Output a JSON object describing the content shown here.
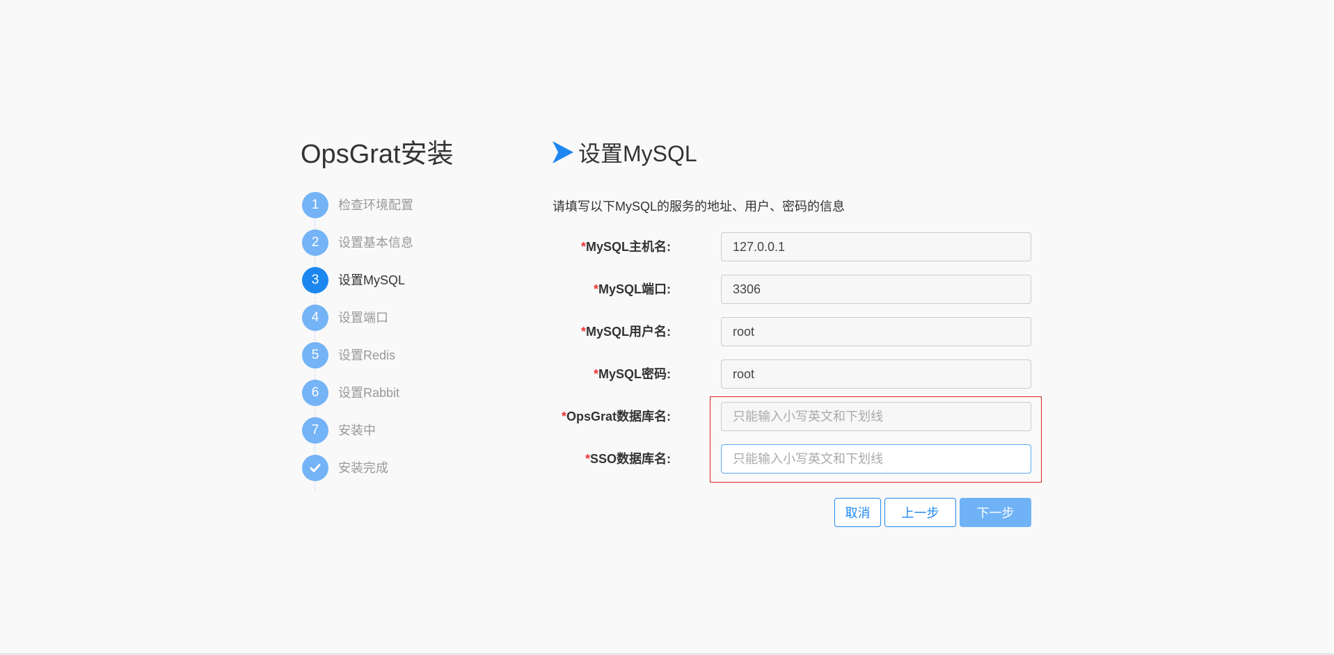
{
  "app": {
    "title": "OpsGrat安装"
  },
  "steps": [
    {
      "number": "1",
      "label": "检查环境配置",
      "state": "done"
    },
    {
      "number": "2",
      "label": "设置基本信息",
      "state": "done"
    },
    {
      "number": "3",
      "label": "设置MySQL",
      "state": "active"
    },
    {
      "number": "4",
      "label": "设置端口",
      "state": "pending"
    },
    {
      "number": "5",
      "label": "设置Redis",
      "state": "pending"
    },
    {
      "number": "6",
      "label": "设置Rabbit",
      "state": "pending"
    },
    {
      "number": "7",
      "label": "安装中",
      "state": "pending"
    },
    {
      "number": "",
      "label": "安装完成",
      "state": "pending",
      "icon": "check-icon"
    }
  ],
  "section": {
    "icon": "arrow-right-icon",
    "title": "设置MySQL",
    "intro": "请填写以下MySQL的服务的地址、用户、密码的信息"
  },
  "form": {
    "required_mark": "*",
    "fields": [
      {
        "label": "MySQL主机名:",
        "value": "127.0.0.1",
        "placeholder": ""
      },
      {
        "label": "MySQL端口:",
        "value": "3306",
        "placeholder": ""
      },
      {
        "label": "MySQL用户名:",
        "value": "root",
        "placeholder": ""
      },
      {
        "label": "MySQL密码:",
        "value": "root",
        "placeholder": ""
      },
      {
        "label": "OpsGrat数据库名:",
        "value": "",
        "placeholder": "只能输入小写英文和下划线"
      },
      {
        "label": "SSO数据库名:",
        "value": "",
        "placeholder": "只能输入小写英文和下划线"
      }
    ]
  },
  "actions": {
    "cancel_label": "取消",
    "prev_label": "上一步",
    "next_label": "下一步"
  },
  "colors": {
    "accent": "#1d87f0",
    "step_inactive": "#74b3f6",
    "required": "#e33333",
    "highlight_border": "#e02020"
  }
}
